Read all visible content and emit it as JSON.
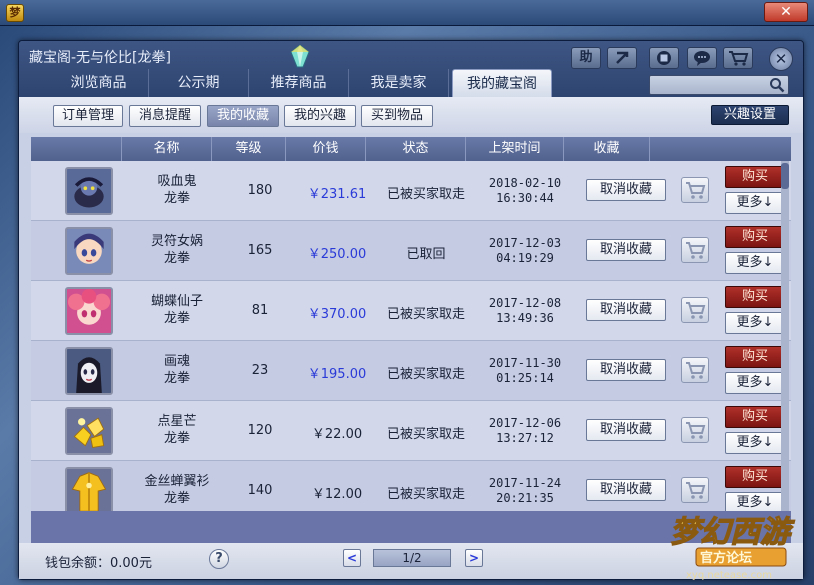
{
  "window": {
    "title": "藏宝阁-无与伦比[龙拳]"
  },
  "toolbar": {
    "help_label": "助"
  },
  "tabs": [
    {
      "label": "浏览商品",
      "active": false
    },
    {
      "label": "公示期",
      "active": false
    },
    {
      "label": "推荐商品",
      "active": false
    },
    {
      "label": "我是卖家",
      "active": false
    },
    {
      "label": "我的藏宝阁",
      "active": true
    }
  ],
  "search": {
    "value": ""
  },
  "subtabs": [
    {
      "label": "订单管理",
      "active": false
    },
    {
      "label": "消息提醒",
      "active": false
    },
    {
      "label": "我的收藏",
      "active": true
    },
    {
      "label": "我的兴趣",
      "active": false
    },
    {
      "label": "买到物品",
      "active": false
    }
  ],
  "interest_button": "兴趣设置",
  "table": {
    "columns": [
      "名称",
      "等级",
      "价钱",
      "状态",
      "上架时间",
      "收藏"
    ],
    "unfavorite_label": "取消收藏",
    "buy_label": "购买",
    "more_label": "更多↓",
    "rows": [
      {
        "name": "吸血鬼",
        "school": "龙拳",
        "level": "180",
        "price": "￥231.61",
        "price_color": "#2a3ad8",
        "status": "已被买家取走",
        "date": "2018-02-10",
        "time": "16:30:44",
        "avatar": "vampire"
      },
      {
        "name": "灵符女娲",
        "school": "龙拳",
        "level": "165",
        "price": "￥250.00",
        "price_color": "#2a3ad8",
        "status": "已取回",
        "date": "2017-12-03",
        "time": "04:19:29",
        "avatar": "nuwa"
      },
      {
        "name": "蝴蝶仙子",
        "school": "龙拳",
        "level": "81",
        "price": "￥370.00",
        "price_color": "#2a3ad8",
        "status": "已被买家取走",
        "date": "2017-12-08",
        "time": "13:49:36",
        "avatar": "butterfly"
      },
      {
        "name": "画魂",
        "school": "龙拳",
        "level": "23",
        "price": "￥195.00",
        "price_color": "#2a3ad8",
        "status": "已被买家取走",
        "date": "2017-11-30",
        "time": "01:25:14",
        "avatar": "huahun"
      },
      {
        "name": "点星芒",
        "school": "龙拳",
        "level": "120",
        "price": "￥22.00",
        "price_color": "#1a2238",
        "status": "已被买家取走",
        "date": "2017-12-06",
        "time": "13:27:12",
        "avatar": "gold-item"
      },
      {
        "name": "金丝蝉翼衫",
        "school": "龙拳",
        "level": "140",
        "price": "￥12.00",
        "price_color": "#1a2238",
        "status": "已被买家取走",
        "date": "2017-11-24",
        "time": "20:21:35",
        "avatar": "gold-robe"
      }
    ]
  },
  "footer": {
    "wallet": "钱包余额：0.00元",
    "help": "?",
    "page": "1/2",
    "prev": "<",
    "next": ">"
  },
  "watermark": {
    "text": "梦幻西游 官方论坛",
    "url": "xyq.netease.com"
  }
}
